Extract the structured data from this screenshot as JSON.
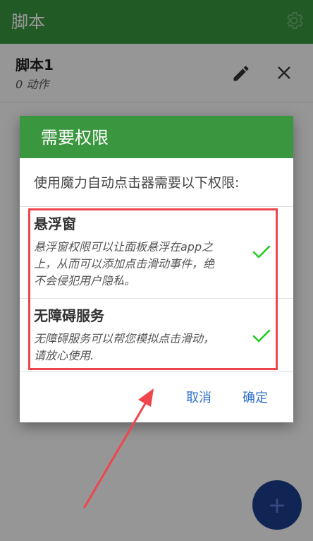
{
  "appbar": {
    "title": "脚本",
    "settings_icon": "gear-icon"
  },
  "script": {
    "name": "脚本1",
    "actions": "0 动作",
    "edit_icon": "pencil-icon",
    "close_icon": "close-icon"
  },
  "dialog": {
    "title": "需要权限",
    "description": "使用魔力自动点击器需要以下权限:",
    "permissions": [
      {
        "title": "悬浮窗",
        "desc_lines": [
          "悬浮窗权限可以让面板悬浮在app之",
          "上，从而可以添加点击滑动事件，绝",
          "不会侵犯用户隐私。"
        ],
        "granted": true
      },
      {
        "title": "无障碍服务",
        "desc_lines": [
          "无障碍服务可以帮您模拟点击滑动，",
          "请放心使用."
        ],
        "granted": true
      }
    ],
    "cancel_label": "取消",
    "ok_label": "确定"
  },
  "fab": {
    "label": "+"
  },
  "colors": {
    "primary_green": "#3a963f",
    "accent_blue": "#2e6fcf",
    "check_green": "#22cc22",
    "annotation_red": "#f0454d",
    "fab_blue": "#1c3e8a"
  }
}
